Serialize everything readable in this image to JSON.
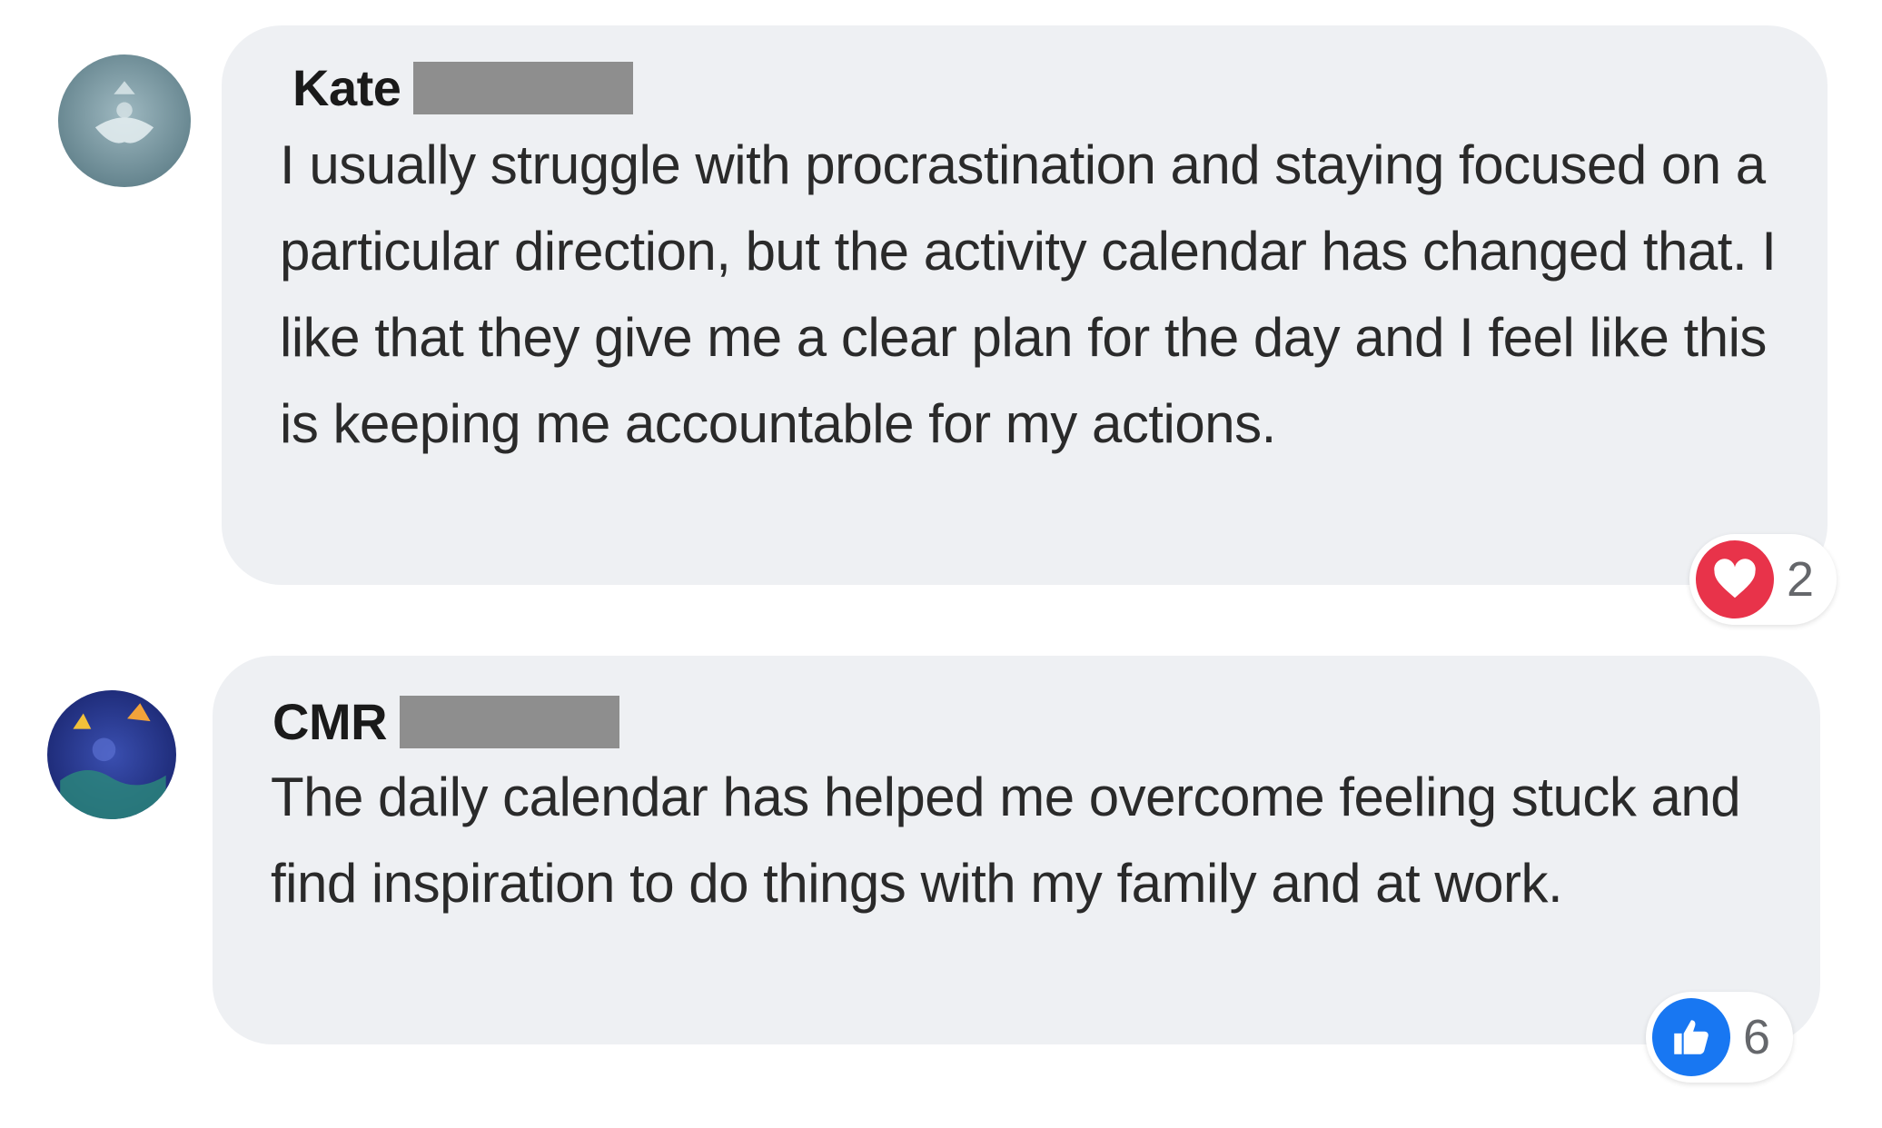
{
  "comments": [
    {
      "author": "Kate",
      "text": "I usually struggle with procrastination and staying focused on a particular direction, but the activity calendar has changed that. I like that they give me a clear plan for the day and I feel like this is keeping me accountable for my actions.",
      "reaction": {
        "icon": "heart-icon",
        "count": "2",
        "color": "#e8334a"
      }
    },
    {
      "author": "CMR",
      "text": "The daily calendar has helped me overcome feeling stuck and find inspiration to do things with my family and at work.",
      "reaction": {
        "icon": "thumbs-up-icon",
        "count": "6",
        "color": "#1877f2"
      }
    }
  ]
}
